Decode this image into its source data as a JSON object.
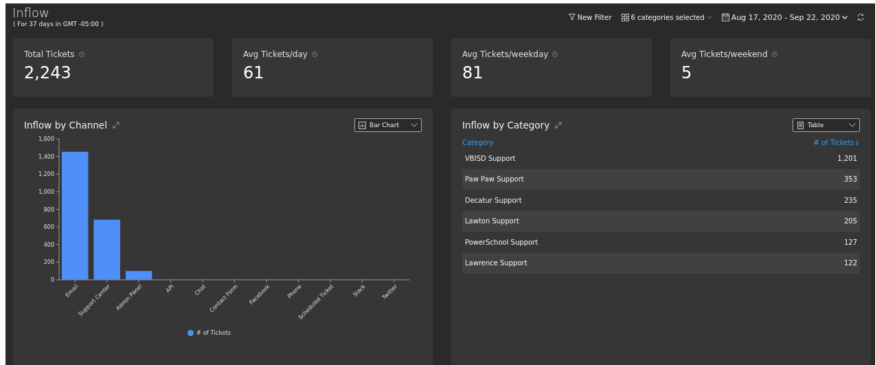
{
  "page": {
    "title": "Inflow",
    "subtitle": "( For 37 days in GMT -05:00 )"
  },
  "toolbar": {
    "filter_button": "New Filter",
    "categories_dropdown": "6 categories selected",
    "date_range": "Aug 17, 2020 - Sep 22, 2020"
  },
  "stats": [
    {
      "label": "Total Tickets",
      "value": "2,243"
    },
    {
      "label": "Avg Tickets/day",
      "value": "61"
    },
    {
      "label": "Avg Tickets/weekday",
      "value": "81"
    },
    {
      "label": "Avg Tickets/weekend",
      "value": "5"
    }
  ],
  "channel_panel": {
    "title": "Inflow by Channel",
    "view_dropdown": "Bar Chart",
    "chart_data": {
      "type": "bar",
      "categories": [
        "Email",
        "Support Center",
        "Admin Panel",
        "API",
        "Chat",
        "Contact Form",
        "Facebook",
        "Phone",
        "Scheduled Ticket",
        "Slack",
        "Twitter"
      ],
      "series": [
        {
          "name": "# of Tickets",
          "color": "#4f8ff7",
          "values": [
            1453,
            682,
            100,
            null,
            null,
            null,
            null,
            null,
            null,
            null,
            null
          ]
        }
      ],
      "ylim": [
        0,
        1600
      ],
      "yticks": [
        {
          "value": 0,
          "label": "0"
        },
        {
          "value": 200,
          "label": "200"
        },
        {
          "value": 400,
          "label": "400"
        },
        {
          "value": 600,
          "label": "600"
        },
        {
          "value": 800,
          "label": "800"
        },
        {
          "value": 1000,
          "label": "1,000"
        },
        {
          "value": 1200,
          "label": "1,200"
        },
        {
          "value": 1400,
          "label": "1,400"
        },
        {
          "value": 1600,
          "label": "1,600"
        }
      ]
    }
  },
  "category_panel": {
    "title": "Inflow by Category",
    "view_dropdown": "Table",
    "table": {
      "columns": [
        "Category",
        "# of Tickets"
      ],
      "sort_indicator": "↓",
      "rows": [
        [
          "VBISD Support",
          "1,201"
        ],
        [
          "Paw Paw Support",
          "353"
        ],
        [
          "Decatur Support",
          "235"
        ],
        [
          "Lawton Support",
          "205"
        ],
        [
          "PowerSchool Support",
          "127"
        ],
        [
          "Lawrence Support",
          "122"
        ]
      ]
    }
  }
}
